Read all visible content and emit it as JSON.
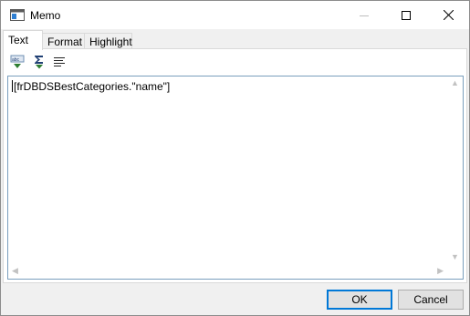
{
  "window": {
    "title": "Memo",
    "icons": {
      "app": "window-icon",
      "minimize": "minimize-icon",
      "maximize": "maximize-icon",
      "close": "close-icon"
    }
  },
  "tabs": [
    {
      "label": "Text",
      "active": true
    },
    {
      "label": "Format",
      "active": false
    },
    {
      "label": "Highlight",
      "active": false
    }
  ],
  "toolbar": {
    "items": [
      {
        "icon": "spell-check-icon"
      },
      {
        "icon": "sum-icon"
      },
      {
        "icon": "word-wrap-icon"
      }
    ]
  },
  "editor": {
    "content": "[frDBDSBestCategories.\"name\"]"
  },
  "buttons": {
    "ok": "OK",
    "cancel": "Cancel"
  },
  "colors": {
    "accent": "#0078d7",
    "editor_border": "#7a9ebd",
    "icon_green": "#2e7d32"
  }
}
